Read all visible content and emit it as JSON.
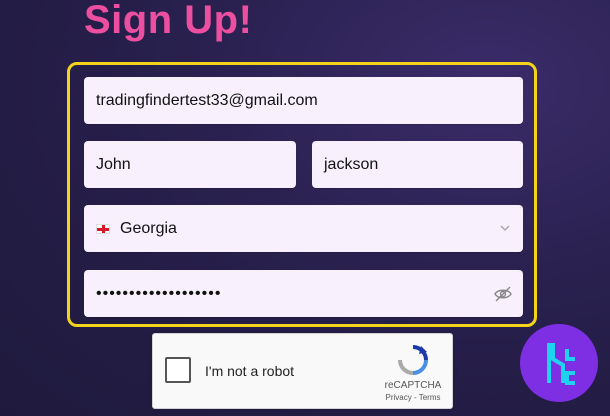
{
  "header": {
    "title": "Sign Up!"
  },
  "form": {
    "email_value": "tradingfindertest33@gmail.com",
    "first_name_value": "John",
    "last_name_value": "jackson",
    "country_value": "Georgia",
    "password_value": "•••••••••••••••••••"
  },
  "captcha": {
    "label": "I'm not a robot",
    "brand": "reCAPTCHA",
    "privacy": "Privacy",
    "sep": " - ",
    "terms": "Terms"
  },
  "colors": {
    "title": "#ec4fa0",
    "frame": "#f3d31b",
    "badge": "#7e2fe3"
  },
  "icons": {
    "country": "georgia-flag-icon",
    "dropdown": "chevron-down-icon",
    "password": "eye-slash-icon",
    "captcha": "recaptcha-icon",
    "brand": "logo-icon"
  }
}
